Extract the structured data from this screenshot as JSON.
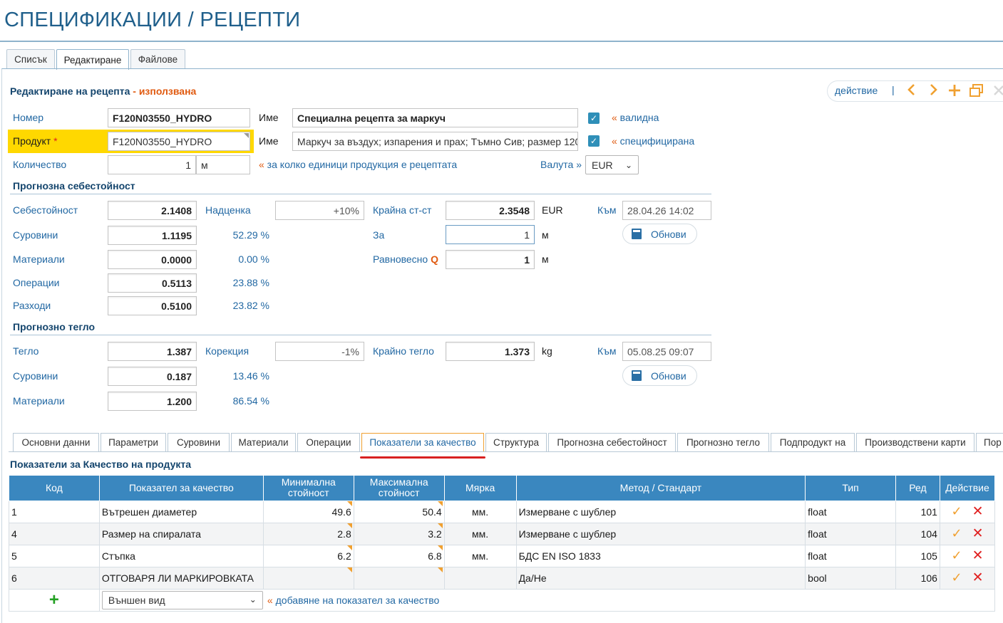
{
  "page": {
    "title": "СПЕЦИФИКАЦИИ / РЕЦЕПТИ"
  },
  "top_tabs": [
    "Списък",
    "Редактиране",
    "Файлове"
  ],
  "header": {
    "title": "Редактиране на рецепта",
    "dash": " - ",
    "status": "използвана",
    "action_label": "действие",
    "separator": "|"
  },
  "fields": {
    "number_label": "Номер",
    "number_value": "F120N03550_HYDRO",
    "name_label": "Име",
    "name_value": "Специална рецепта за маркуч",
    "valid_label": "« валидна",
    "product_label": "Продукт",
    "required_mark": "*",
    "product_value": "F120N03550_HYDRO",
    "name2_label": "Име",
    "name2_value": "Маркуч за въздух; изпарения и прах; Тъмно Сив; размер 120",
    "specified_label": "« специфицирана",
    "qty_label": "Количество",
    "qty_value": "1",
    "qty_unit": "м",
    "qty_hint": "« за колко единици продукция е рецептата",
    "currency_label": "Валута »",
    "currency_value": "EUR"
  },
  "cost": {
    "section": "Прогнозна себестойност",
    "cost_label": "Себестойност",
    "cost_value": "2.1408",
    "markup_label": "Надценка",
    "markup_value": "+10%",
    "final_label": "Крайна ст-ст",
    "final_value": "2.3548",
    "final_unit": "EUR",
    "to_label": "Към",
    "to_value": "28.04.26 14:02",
    "raw_label": "Суровини",
    "raw_value": "1.1195",
    "raw_pct": "52.29 %",
    "for_label": "За",
    "for_value": "1",
    "for_unit": "м",
    "update_label": "Обнови",
    "mat_label": "Материали",
    "mat_value": "0.0000",
    "mat_pct": "0.00 %",
    "eq_label": "Равновесно",
    "eq_q": "Q",
    "eq_value": "1",
    "eq_unit": "м",
    "ops_label": "Операции",
    "ops_value": "0.5113",
    "ops_pct": "23.88 %",
    "exp_label": "Разходи",
    "exp_value": "0.5100",
    "exp_pct": "23.82 %"
  },
  "weight": {
    "section": "Прогнозно тегло",
    "w_label": "Тегло",
    "w_value": "1.387",
    "corr_label": "Корекция",
    "corr_value": "-1%",
    "final_label": "Крайно тегло",
    "final_value": "1.373",
    "final_unit": "kg",
    "to_label": "Към",
    "to_value": "05.08.25 09:07",
    "raw_label": "Суровини",
    "raw_value": "0.187",
    "raw_pct": "13.46 %",
    "update_label": "Обнови",
    "mat_label": "Материали",
    "mat_value": "1.200",
    "mat_pct": "86.54 %"
  },
  "bottom_tabs": [
    "Основни данни",
    "Параметри",
    "Суровини",
    "Материали",
    "Операции",
    "Показатели за качество",
    "Структура",
    "Прогнозна себестойност",
    "Прогнозно тегло",
    "Подпродукт на",
    "Производствени карти",
    "Пор"
  ],
  "quality": {
    "title": "Показатели за Качество на продукта",
    "columns": {
      "code": "Код",
      "indicator": "Показател за качество",
      "min": "Минимална стойност",
      "max": "Максимална стойност",
      "unit": "Мярка",
      "method": "Метод / Стандарт",
      "type": "Тип",
      "row": "Ред",
      "action": "Действие"
    },
    "rows": [
      {
        "code": "1",
        "indicator": "Вътрешен диаметер",
        "min": "49.6",
        "max": "50.4",
        "unit": "мм.",
        "method": "Измерване с шублер",
        "type": "float",
        "row": "101"
      },
      {
        "code": "4",
        "indicator": "Размер на спиралата",
        "min": "2.8",
        "max": "3.2",
        "unit": "мм.",
        "method": "Измерване с шублер",
        "type": "float",
        "row": "104"
      },
      {
        "code": "5",
        "indicator": "Стъпка",
        "min": "6.2",
        "max": "6.8",
        "unit": "мм.",
        "method": "БДС EN ISO 1833",
        "type": "float",
        "row": "105"
      },
      {
        "code": "6",
        "indicator": "ОТГОВАРЯ ЛИ МАРКИРОВКАТА",
        "min": "",
        "max": "",
        "unit": "",
        "method": "Да/Не",
        "type": "bool",
        "row": "106"
      }
    ],
    "add_select": "Външен вид",
    "add_hint": "добавяне на показател за качество",
    "add_hint_prefix": "«"
  },
  "colors": {
    "accent": "#2268a3",
    "header": "#3a87bf",
    "orange": "#f0a030",
    "danger": "#e02020",
    "highlight": "#ffd800"
  }
}
